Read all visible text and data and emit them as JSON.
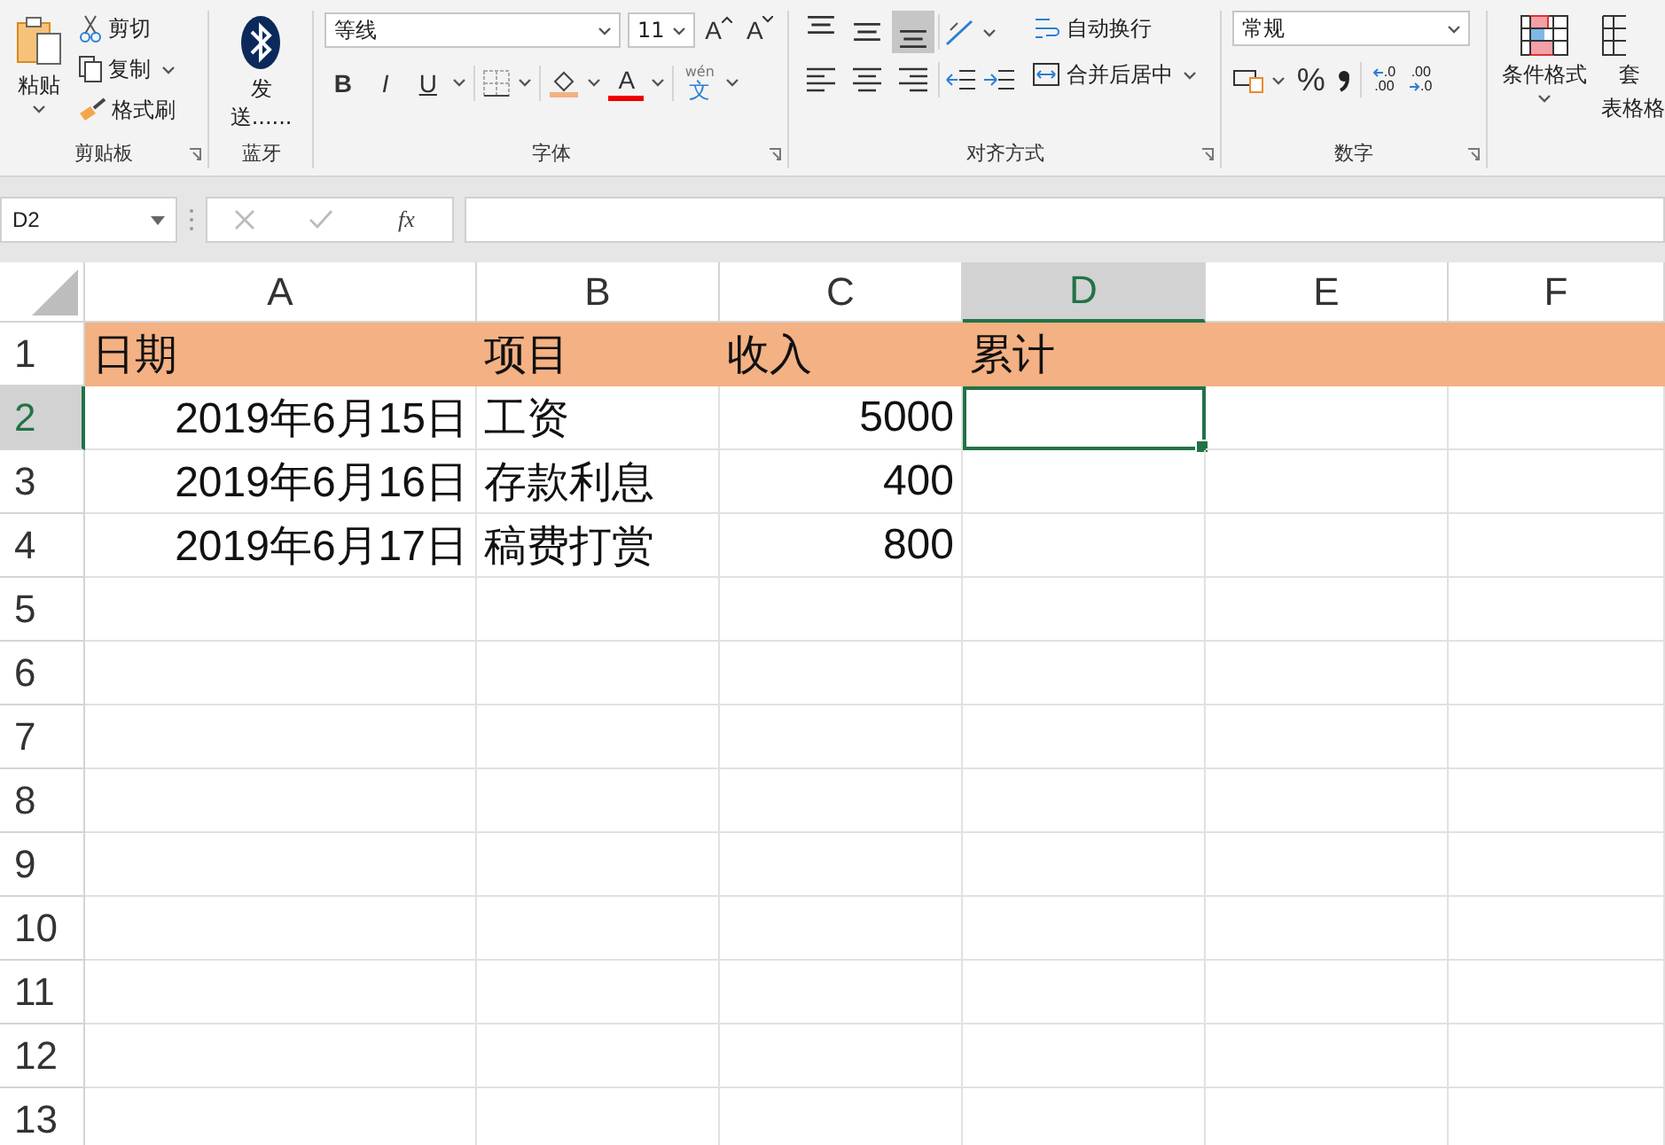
{
  "ribbon": {
    "clipboard": {
      "paste": "粘贴",
      "cut": "剪切",
      "copy": "复制",
      "format_painter": "格式刷",
      "label": "剪贴板"
    },
    "bluetooth": {
      "send": "发送......",
      "label": "蓝牙"
    },
    "font": {
      "name": "等线",
      "size": "11",
      "grow": "A",
      "shrink": "A",
      "bold": "B",
      "italic": "I",
      "underline": "U",
      "font_color": "A",
      "phonetic_top": "wén",
      "phonetic_char": "文",
      "label": "字体"
    },
    "alignment": {
      "vertical": [
        {
          "selected": false
        },
        {
          "selected": false
        },
        {
          "selected": true
        }
      ],
      "wrap_text": "自动换行",
      "merge_center": "合并后居中",
      "label": "对齐方式"
    },
    "number": {
      "format": "常规",
      "percent": "%",
      "decrease_decimal": {
        "top": ".0",
        "bottom": ".00"
      },
      "increase_decimal": {
        "top": ".00",
        "bottom": ".0"
      },
      "label": "数字"
    },
    "styles": {
      "conditional_format": "条件格式",
      "table_format_top": "套",
      "table_format_bottom": "表格格"
    }
  },
  "formula_bar": {
    "name_box": "D2",
    "fx": "fx"
  },
  "sheet": {
    "columns": [
      {
        "label": "A",
        "selected": false
      },
      {
        "label": "B",
        "selected": false
      },
      {
        "label": "C",
        "selected": false
      },
      {
        "label": "D",
        "selected": true
      },
      {
        "label": "E",
        "selected": false
      },
      {
        "label": "F",
        "selected": false
      }
    ],
    "rows": [
      {
        "header": "1",
        "selected": false,
        "shaded": true,
        "cells": [
          {
            "text": "日期",
            "kind": "text",
            "selected": false
          },
          {
            "text": "项目",
            "kind": "text",
            "selected": false
          },
          {
            "text": "收入",
            "kind": "text",
            "selected": false
          },
          {
            "text": "累计",
            "kind": "text",
            "selected": false
          },
          {
            "selected": false
          },
          {
            "selected": false
          }
        ]
      },
      {
        "header": "2",
        "selected": true,
        "shaded": false,
        "cells": [
          {
            "text": "2019年6月15日",
            "kind": "number",
            "selected": false
          },
          {
            "text": "工资",
            "kind": "text",
            "selected": false
          },
          {
            "text": "5000",
            "kind": "number",
            "selected": false
          },
          {
            "selected": true
          },
          {
            "selected": false
          },
          {
            "selected": false
          }
        ]
      },
      {
        "header": "3",
        "selected": false,
        "shaded": false,
        "cells": [
          {
            "text": "2019年6月16日",
            "kind": "number",
            "selected": false
          },
          {
            "text": "存款利息",
            "kind": "text",
            "selected": false
          },
          {
            "text": "400",
            "kind": "number",
            "selected": false
          },
          {
            "selected": false
          },
          {
            "selected": false
          },
          {
            "selected": false
          }
        ]
      },
      {
        "header": "4",
        "selected": false,
        "shaded": false,
        "cells": [
          {
            "text": "2019年6月17日",
            "kind": "number",
            "selected": false
          },
          {
            "text": "稿费打赏",
            "kind": "text",
            "selected": false
          },
          {
            "text": "800",
            "kind": "number",
            "selected": false
          },
          {
            "selected": false
          },
          {
            "selected": false
          },
          {
            "selected": false
          }
        ]
      },
      {
        "header": "5",
        "selected": false,
        "shaded": false,
        "cells": [
          {
            "selected": false
          },
          {
            "selected": false
          },
          {
            "selected": false
          },
          {
            "selected": false
          },
          {
            "selected": false
          },
          {
            "selected": false
          }
        ]
      },
      {
        "header": "6",
        "selected": false,
        "shaded": false,
        "cells": [
          {
            "selected": false
          },
          {
            "selected": false
          },
          {
            "selected": false
          },
          {
            "selected": false
          },
          {
            "selected": false
          },
          {
            "selected": false
          }
        ]
      },
      {
        "header": "7",
        "selected": false,
        "shaded": false,
        "cells": [
          {
            "selected": false
          },
          {
            "selected": false
          },
          {
            "selected": false
          },
          {
            "selected": false
          },
          {
            "selected": false
          },
          {
            "selected": false
          }
        ]
      },
      {
        "header": "8",
        "selected": false,
        "shaded": false,
        "cells": [
          {
            "selected": false
          },
          {
            "selected": false
          },
          {
            "selected": false
          },
          {
            "selected": false
          },
          {
            "selected": false
          },
          {
            "selected": false
          }
        ]
      },
      {
        "header": "9",
        "selected": false,
        "shaded": false,
        "cells": [
          {
            "selected": false
          },
          {
            "selected": false
          },
          {
            "selected": false
          },
          {
            "selected": false
          },
          {
            "selected": false
          },
          {
            "selected": false
          }
        ]
      },
      {
        "header": "10",
        "selected": false,
        "shaded": false,
        "cells": [
          {
            "selected": false
          },
          {
            "selected": false
          },
          {
            "selected": false
          },
          {
            "selected": false
          },
          {
            "selected": false
          },
          {
            "selected": false
          }
        ]
      },
      {
        "header": "11",
        "selected": false,
        "shaded": false,
        "cells": [
          {
            "selected": false
          },
          {
            "selected": false
          },
          {
            "selected": false
          },
          {
            "selected": false
          },
          {
            "selected": false
          },
          {
            "selected": false
          }
        ]
      },
      {
        "header": "12",
        "selected": false,
        "shaded": false,
        "cells": [
          {
            "selected": false
          },
          {
            "selected": false
          },
          {
            "selected": false
          },
          {
            "selected": false
          },
          {
            "selected": false
          },
          {
            "selected": false
          }
        ]
      },
      {
        "header": "13",
        "selected": false,
        "shaded": false,
        "cells": [
          {
            "selected": false
          },
          {
            "selected": false
          },
          {
            "selected": false
          },
          {
            "selected": false
          },
          {
            "selected": false
          },
          {
            "selected": false
          }
        ]
      }
    ]
  }
}
